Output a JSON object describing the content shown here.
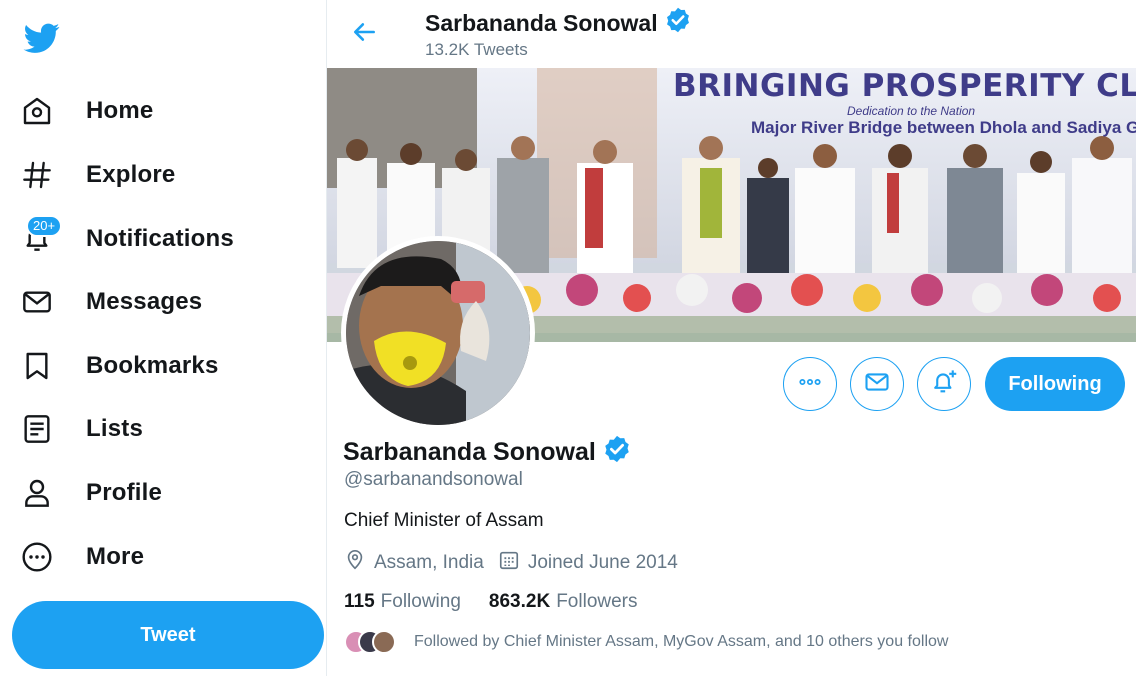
{
  "sidebar": {
    "logo_icon": "twitter-bird-icon",
    "items": [
      {
        "label": "Home",
        "icon": "home-icon"
      },
      {
        "label": "Explore",
        "icon": "hashtag-icon"
      },
      {
        "label": "Notifications",
        "icon": "bell-icon",
        "badge": "20+"
      },
      {
        "label": "Messages",
        "icon": "envelope-icon"
      },
      {
        "label": "Bookmarks",
        "icon": "bookmark-icon"
      },
      {
        "label": "Lists",
        "icon": "list-icon"
      },
      {
        "label": "Profile",
        "icon": "person-icon"
      },
      {
        "label": "More",
        "icon": "more-circle-icon"
      }
    ],
    "tweet_label": "Tweet"
  },
  "header": {
    "name": "Sarbananda Sonowal",
    "tweet_count": "13.2K Tweets"
  },
  "banner": {
    "title": "BRINGING PROSPERITY CLOSER",
    "subtitle1": "Dedication to the Nation",
    "subtitle2": "Major River Bridge between Dhola and Sadiya G"
  },
  "actions": {
    "following_label": "Following"
  },
  "profile": {
    "name": "Sarbananda Sonowal",
    "handle": "@sarbanandsonowal",
    "bio": "Chief Minister of Assam",
    "location": "Assam, India",
    "joined": "Joined June 2014",
    "following_count": "115",
    "following_label": "Following",
    "followers_count": "863.2K",
    "followers_label": "Followers",
    "followed_by": "Followed by Chief Minister Assam, MyGov Assam, and 10 others you follow"
  },
  "colors": {
    "accent": "#1da1f2",
    "text": "#14171a",
    "secondary": "#657786"
  }
}
